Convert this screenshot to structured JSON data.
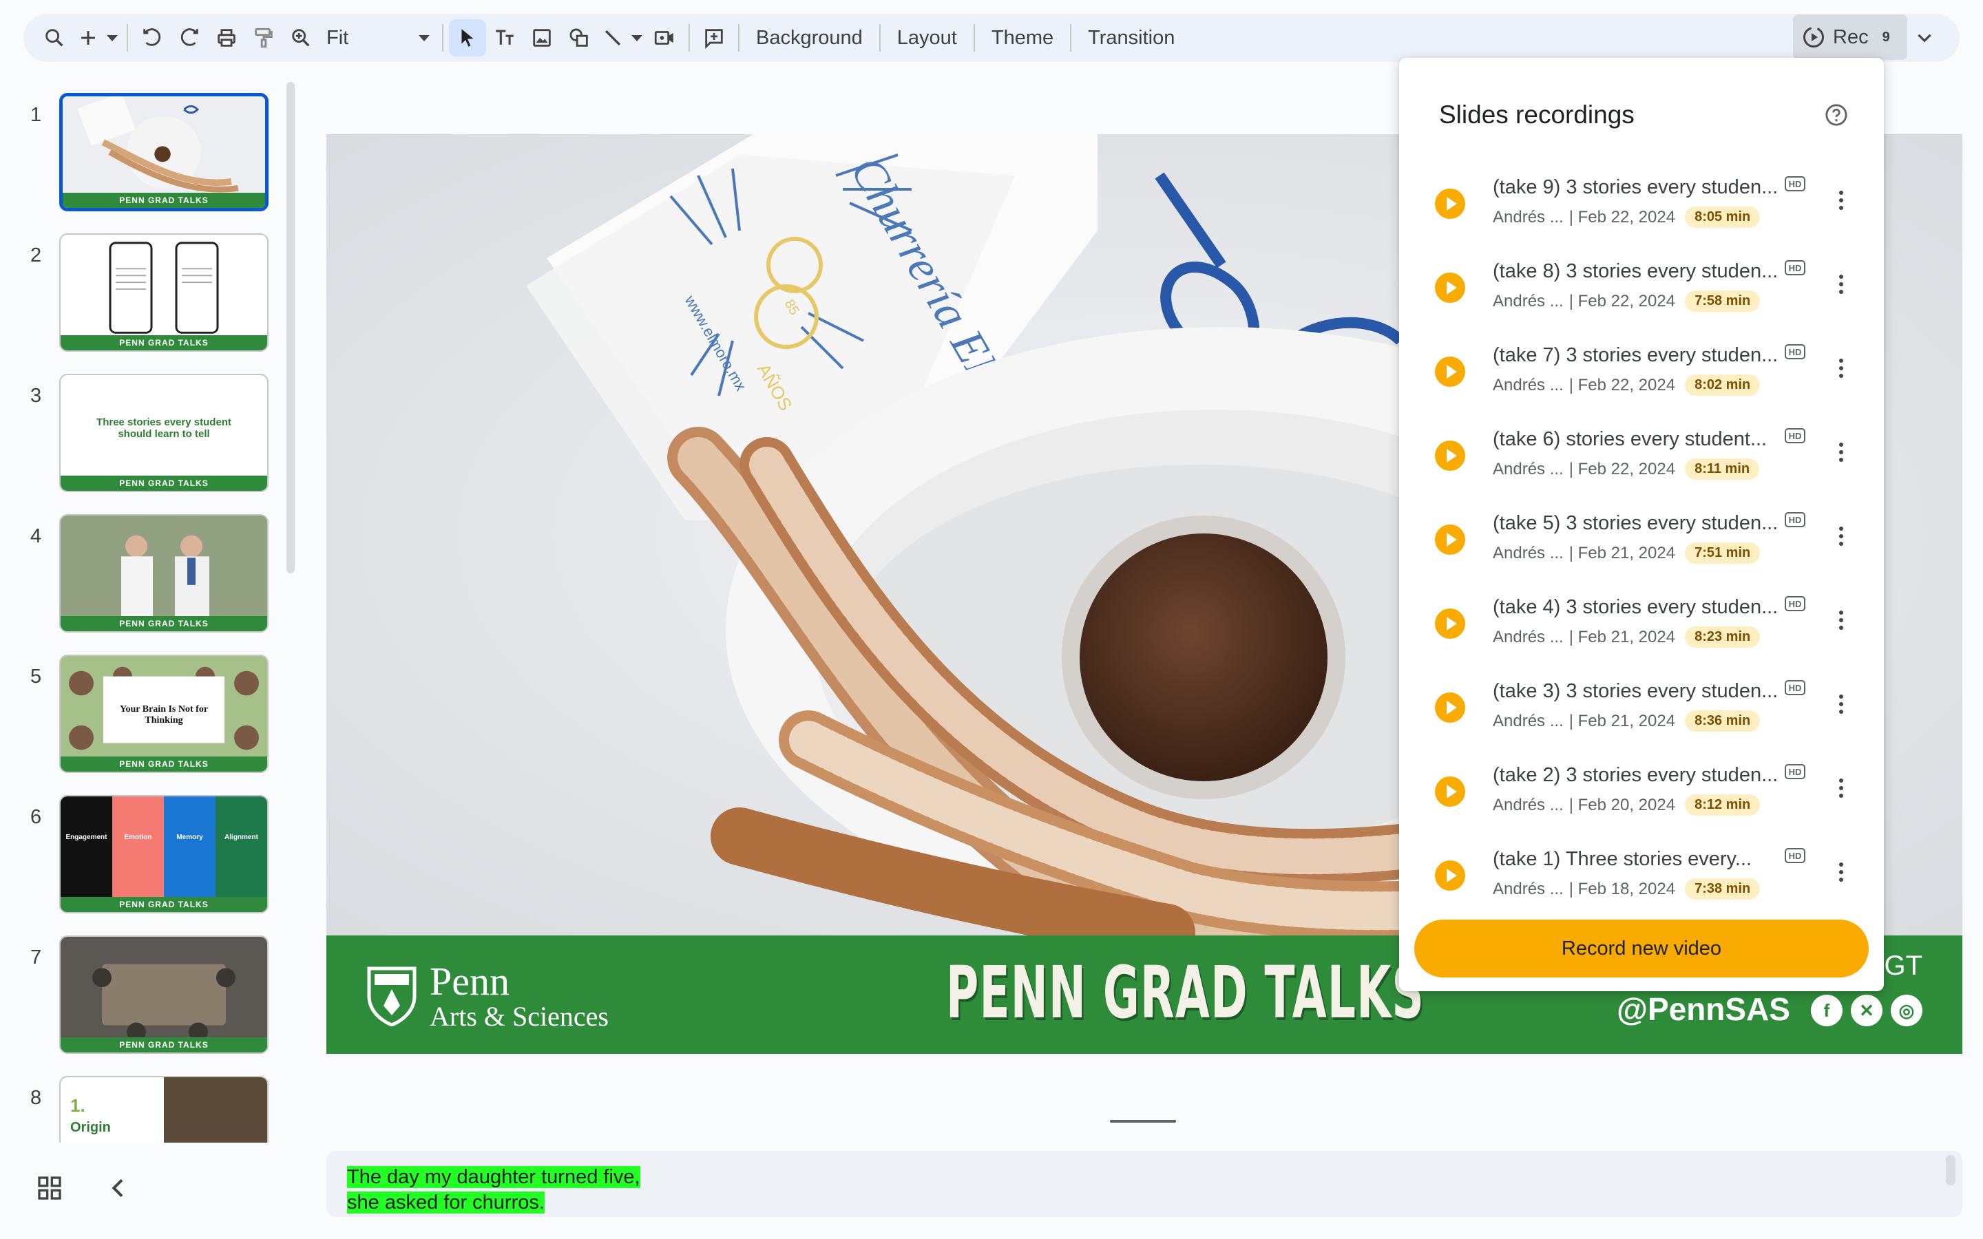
{
  "toolbar": {
    "zoom_value": "Fit",
    "background_label": "Background",
    "layout_label": "Layout",
    "theme_label": "Theme",
    "transition_label": "Transition",
    "rec_label": "Rec",
    "rec_count": "9"
  },
  "filmstrip": {
    "slides": [
      {
        "num": "1",
        "footer": "PENN GRAD TALKS"
      },
      {
        "num": "2",
        "footer": "PENN GRAD TALKS"
      },
      {
        "num": "3",
        "title": "Three stories every student should learn to tell",
        "footer": "PENN GRAD TALKS"
      },
      {
        "num": "4",
        "footer": "PENN GRAD TALKS"
      },
      {
        "num": "5",
        "headline": "Your Brain Is Not for Thinking",
        "footer": "PENN GRAD TALKS"
      },
      {
        "num": "6",
        "labels": [
          "Engagement",
          "Emotion",
          "Memory",
          "Alignment"
        ],
        "footer": "PENN GRAD TALKS"
      },
      {
        "num": "7",
        "footer": "PENN GRAD TALKS"
      },
      {
        "num": "8",
        "title_num": "1.",
        "title": "Origin"
      }
    ]
  },
  "slide": {
    "napkin_brand": "Churrería EL MORO",
    "napkin_years": "85",
    "napkin_anos": "AÑOS",
    "napkin_url": "www.elmoro.mx",
    "footer_brand_big": "Penn",
    "footer_brand_small": "Arts & Sciences",
    "footer_title": "PENN GRAD TALKS",
    "footer_handle": "@PennSAS",
    "footer_gt": "GT",
    "colors": {
      "footer_green": "#2e8b3a",
      "accent_orange": "#f9ab00"
    }
  },
  "notes": {
    "line1": "The day my daughter turned five,",
    "line2": "she asked for churros."
  },
  "recordings_panel": {
    "title": "Slides recordings",
    "items": [
      {
        "title": "(take 9) 3 stories every studen...",
        "author": "Andrés ...",
        "date": "| Feb 22, 2024",
        "duration": "8:05 min",
        "badge": "HD"
      },
      {
        "title": "(take 8) 3 stories every studen...",
        "author": "Andrés ...",
        "date": "| Feb 22, 2024",
        "duration": "7:58 min",
        "badge": "HD"
      },
      {
        "title": "(take 7) 3 stories every studen...",
        "author": "Andrés ...",
        "date": "| Feb 22, 2024",
        "duration": "8:02 min",
        "badge": "HD"
      },
      {
        "title": "(take 6) stories every student...",
        "author": "Andrés ...",
        "date": "| Feb 22, 2024",
        "duration": "8:11 min",
        "badge": "HD"
      },
      {
        "title": "(take 5) 3 stories every studen...",
        "author": "Andrés ...",
        "date": "| Feb 21, 2024",
        "duration": "7:51 min",
        "badge": "HD"
      },
      {
        "title": "(take 4) 3 stories every studen...",
        "author": "Andrés ...",
        "date": "| Feb 21, 2024",
        "duration": "8:23 min",
        "badge": "HD"
      },
      {
        "title": "(take 3) 3 stories every studen...",
        "author": "Andrés ...",
        "date": "| Feb 21, 2024",
        "duration": "8:36 min",
        "badge": "HD"
      },
      {
        "title": "(take 2) 3 stories every studen...",
        "author": "Andrés ...",
        "date": "| Feb 20, 2024",
        "duration": "8:12 min",
        "badge": "HD"
      },
      {
        "title": "(take 1) Three stories every...",
        "author": "Andrés ...",
        "date": "| Feb 18, 2024",
        "duration": "7:38 min",
        "badge": "HD"
      }
    ],
    "record_button": "Record new video"
  }
}
